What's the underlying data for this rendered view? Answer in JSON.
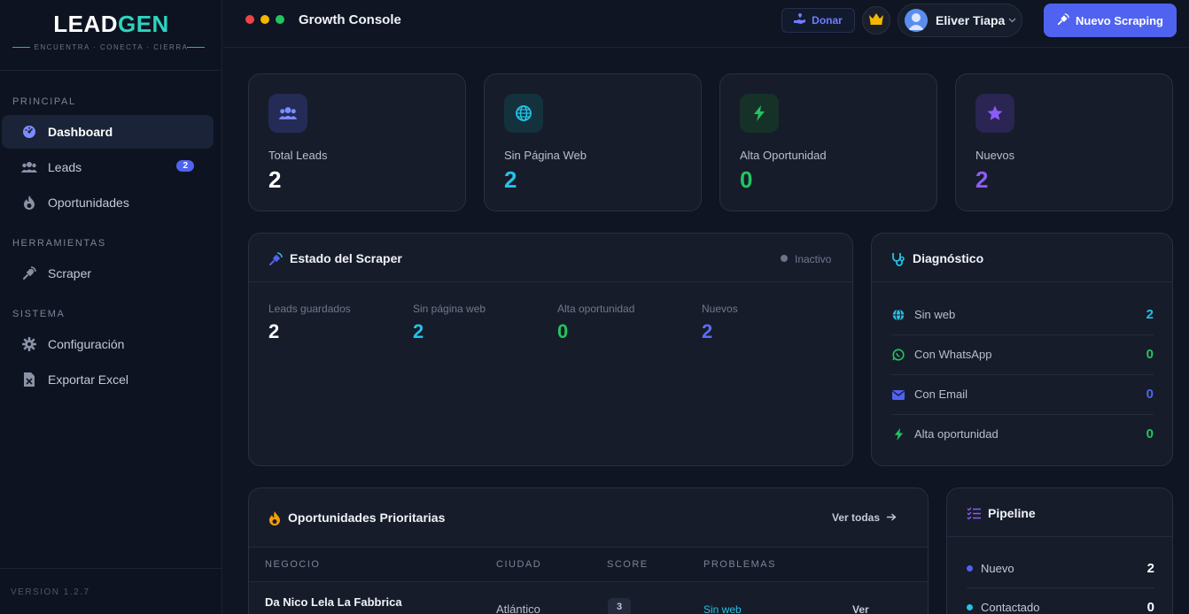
{
  "brand": {
    "lead": "LEAD",
    "gen": "GEN",
    "tagline": "ENCUENTRA · CONECTA · CIERRA"
  },
  "sidebar": {
    "sections": [
      "PRINCIPAL",
      "HERRAMIENTAS",
      "SISTEMA"
    ],
    "items": [
      {
        "label": "Dashboard",
        "icon": "gauge-icon"
      },
      {
        "label": "Leads",
        "icon": "users-icon",
        "badge": "2"
      },
      {
        "label": "Oportunidades",
        "icon": "flame-icon"
      },
      {
        "label": "Scraper",
        "icon": "satellite-icon"
      },
      {
        "label": "Configuración",
        "icon": "gear-icon"
      },
      {
        "label": "Exportar Excel",
        "icon": "excel-file-icon"
      }
    ],
    "version": "VERSION 1.2.7"
  },
  "topbar": {
    "title": "Growth Console",
    "donate": "Donar",
    "user": "Eliver Tiapa",
    "primary": "Nuevo Scraping"
  },
  "stats": [
    {
      "label": "Total Leads",
      "value": "2",
      "color": "#ffffff"
    },
    {
      "label": "Sin Página Web",
      "value": "2",
      "color": "#22c3e6"
    },
    {
      "label": "Alta Oportunidad",
      "value": "0",
      "color": "#22c55e"
    },
    {
      "label": "Nuevos",
      "value": "2",
      "color": "#8b5cf6"
    }
  ],
  "scraper": {
    "title": "Estado del Scraper",
    "status": "Inactivo",
    "metrics": [
      {
        "label": "Leads guardados",
        "value": "2"
      },
      {
        "label": "Sin página web",
        "value": "2"
      },
      {
        "label": "Alta oportunidad",
        "value": "0"
      },
      {
        "label": "Nuevos",
        "value": "2"
      }
    ]
  },
  "diagnostico": {
    "title": "Diagnóstico",
    "rows": [
      {
        "label": "Sin web",
        "value": "2"
      },
      {
        "label": "Con WhatsApp",
        "value": "0"
      },
      {
        "label": "Con Email",
        "value": "0"
      },
      {
        "label": "Alta oportunidad",
        "value": "0"
      }
    ]
  },
  "oportunidades": {
    "title": "Oportunidades Prioritarias",
    "link": "Ver todas",
    "columns": [
      "NEGOCIO",
      "CIUDAD",
      "SCORE",
      "PROBLEMAS"
    ],
    "rows": [
      {
        "negocio": "Da Nico Lela La Fabbrica",
        "ciudad": "Atlántico",
        "score": "3",
        "problemas": "Sin web",
        "action": "Ver"
      }
    ]
  },
  "pipeline": {
    "title": "Pipeline",
    "rows": [
      {
        "label": "Nuevo",
        "value": "2"
      },
      {
        "label": "Contactado",
        "value": "0"
      }
    ]
  }
}
